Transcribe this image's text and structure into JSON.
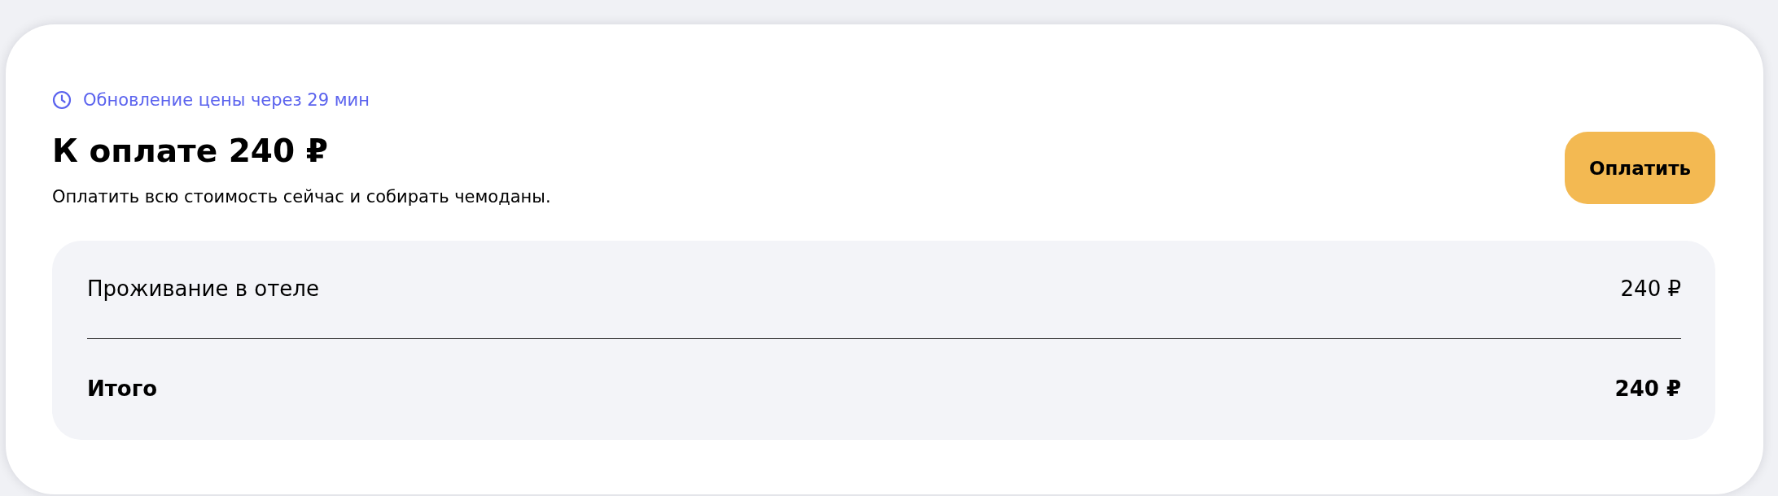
{
  "timer": {
    "text": "Обновление цены через 29 мин"
  },
  "title": "К оплате 240 ₽",
  "subtitle": "Оплатить всю стоимость сейчас и собирать чемоданы.",
  "pay_button": {
    "label": "Оплатить"
  },
  "breakdown": [
    {
      "kind": "item",
      "label": "Проживание в отеле",
      "value": "240 ₽"
    },
    {
      "kind": "total",
      "label": "Итого",
      "value": "240 ₽"
    }
  ]
}
